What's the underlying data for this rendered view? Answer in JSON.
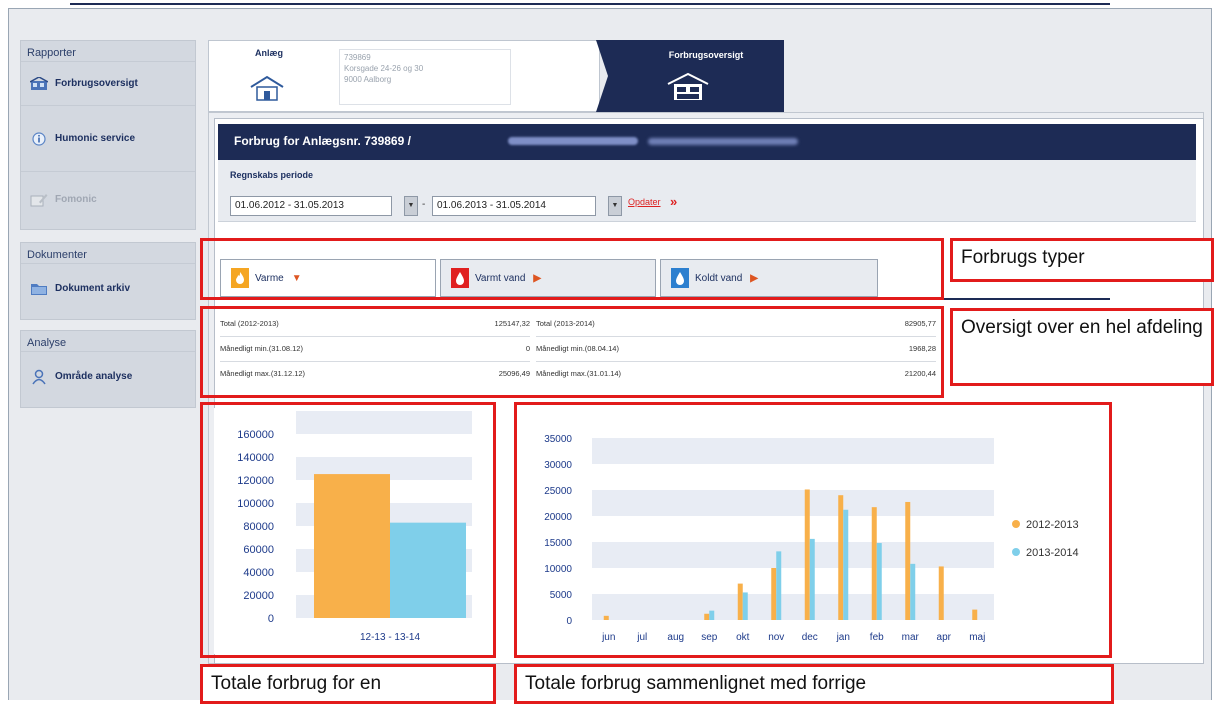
{
  "sidebar": {
    "rapporter": {
      "heading": "Rapporter",
      "items": [
        {
          "label": "Forbrugsoversigt",
          "icon": "house-icon"
        },
        {
          "label": "Humonic service",
          "icon": "info-icon"
        },
        {
          "label": "Fomonic",
          "icon": "pencil-icon"
        }
      ]
    },
    "dokumenter": {
      "heading": "Dokumenter",
      "items": [
        {
          "label": "Dokument arkiv",
          "icon": "folder-icon"
        }
      ]
    },
    "analyse": {
      "heading": "Analyse",
      "items": [
        {
          "label": "Område analyse",
          "icon": "person-icon"
        }
      ]
    }
  },
  "tabs": {
    "anlaeg": {
      "label": "Anlæg",
      "address_lines": [
        "739869",
        "Korsgade 24-26 og 30",
        "9000 Aalborg"
      ]
    },
    "forbrugsoversigt": {
      "label": "Forbrugsoversigt"
    }
  },
  "header": {
    "title": "Forbrug for Anlægsnr. 739869 /"
  },
  "period": {
    "label": "Regnskabs periode",
    "from": "01.06.2012 - 31.05.2013",
    "to": "01.06.2013 - 31.05.2014",
    "dash": "-",
    "update_link": "Opdater",
    "update_arrows": "»"
  },
  "types": [
    {
      "label": "Varme",
      "active": true,
      "color": "#f5a623"
    },
    {
      "label": "Varmt vand",
      "active": false,
      "color": "#e02020"
    },
    {
      "label": "Koldt vand",
      "active": false,
      "color": "#2c7fcf"
    }
  ],
  "stats": {
    "left": [
      {
        "label": "Total (2012-2013)",
        "value": "125147,32"
      },
      {
        "label": "Månedligt min.(31.08.12)",
        "value": "0"
      },
      {
        "label": "Månedligt max.(31.12.12)",
        "value": "25096,49"
      }
    ],
    "right": [
      {
        "label": "Total (2013-2014)",
        "value": "82905,77"
      },
      {
        "label": "Månedligt min.(08.04.14)",
        "value": "1968,28"
      },
      {
        "label": "Månedligt max.(31.01.14)",
        "value": "21200,44"
      }
    ]
  },
  "annotations": {
    "types": "Forbrugs typer",
    "overview": "Oversigt over en hel afdeling",
    "total": "Totale forbrug for en",
    "compare": "Totale forbrug sammenlignet med forrige"
  },
  "colors": {
    "series_2012": "#f8b04a",
    "series_2013": "#7fcfea",
    "navy": "#1d2b55",
    "annotation": "#e21b1b"
  },
  "chart_data": [
    {
      "type": "bar",
      "categories": [
        "12-13 - 13-14"
      ],
      "series": [
        {
          "name": "2012-2013",
          "values": [
            125147
          ]
        },
        {
          "name": "2013-2014",
          "values": [
            82906
          ]
        }
      ],
      "ylim": [
        0,
        160000
      ],
      "yticks": [
        "160000",
        "140000",
        "120000",
        "100000",
        "80000",
        "60000",
        "40000",
        "20000",
        "0"
      ],
      "xlabel": "12-13 - 13-14"
    },
    {
      "type": "bar",
      "categories": [
        "jun",
        "jul",
        "aug",
        "sep",
        "okt",
        "nov",
        "dec",
        "jan",
        "feb",
        "mar",
        "apr",
        "maj"
      ],
      "series": [
        {
          "name": "2012-2013",
          "values": [
            800,
            0,
            0,
            1200,
            7000,
            10000,
            25100,
            24000,
            21700,
            22700,
            10300,
            2000
          ]
        },
        {
          "name": "2013-2014",
          "values": [
            0,
            0,
            0,
            1800,
            5300,
            13200,
            15600,
            21200,
            14800,
            10800,
            0,
            0
          ]
        }
      ],
      "ylim": [
        0,
        35000
      ],
      "yticks": [
        "35000",
        "30000",
        "25000",
        "20000",
        "15000",
        "10000",
        "5000",
        "0"
      ],
      "legend": [
        "2012-2013",
        "2013-2014"
      ],
      "legend_position": "right"
    }
  ]
}
